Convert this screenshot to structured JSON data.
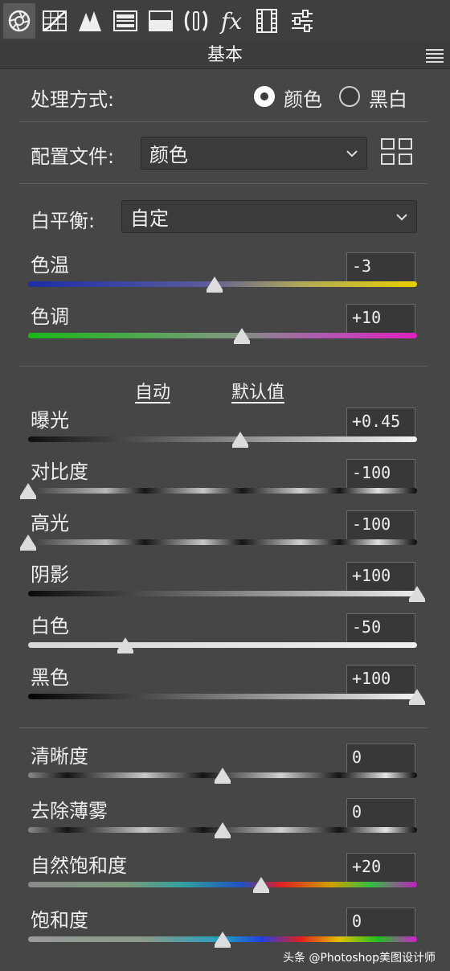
{
  "toolbar": {
    "tabs": [
      {
        "name": "basic-tab-icon",
        "active": true
      },
      {
        "name": "tone-curve-icon"
      },
      {
        "name": "detail-icon"
      },
      {
        "name": "hsl-icon"
      },
      {
        "name": "split-toning-icon"
      },
      {
        "name": "lens-corrections-icon"
      },
      {
        "name": "effects-fx-icon"
      },
      {
        "name": "calibration-icon"
      },
      {
        "name": "presets-sliders-icon"
      }
    ]
  },
  "panel": {
    "title": "基本"
  },
  "treatment": {
    "label": "处理方式:",
    "options": [
      "颜色",
      "黑白"
    ],
    "selected": "颜色"
  },
  "profile": {
    "label": "配置文件:",
    "value": "颜色"
  },
  "white_balance": {
    "label": "白平衡:",
    "value": "自定"
  },
  "sliders_wb": [
    {
      "label": "色温",
      "value": "-3",
      "fraction": 0.48
    },
    {
      "label": "色调",
      "value": "+10",
      "fraction": 0.55
    }
  ],
  "auto_label": "自动",
  "default_label": "默认值",
  "sliders_tone": [
    {
      "label": "曝光",
      "value": "+0.45",
      "fraction": 0.545
    },
    {
      "label": "对比度",
      "value": "-100",
      "fraction": 0.0
    },
    {
      "label": "高光",
      "value": "-100",
      "fraction": 0.0
    },
    {
      "label": "阴影",
      "value": "+100",
      "fraction": 1.0
    },
    {
      "label": "白色",
      "value": "-50",
      "fraction": 0.25
    },
    {
      "label": "黑色",
      "value": "+100",
      "fraction": 1.0
    }
  ],
  "sliders_presence": [
    {
      "label": "清晰度",
      "value": "0",
      "fraction": 0.5
    },
    {
      "label": "去除薄雾",
      "value": "0",
      "fraction": 0.5
    },
    {
      "label": "自然饱和度",
      "value": "+20",
      "fraction": 0.6
    },
    {
      "label": "饱和度",
      "value": "0",
      "fraction": 0.5
    }
  ],
  "watermark": "头条 @Photoshop美图设计师"
}
